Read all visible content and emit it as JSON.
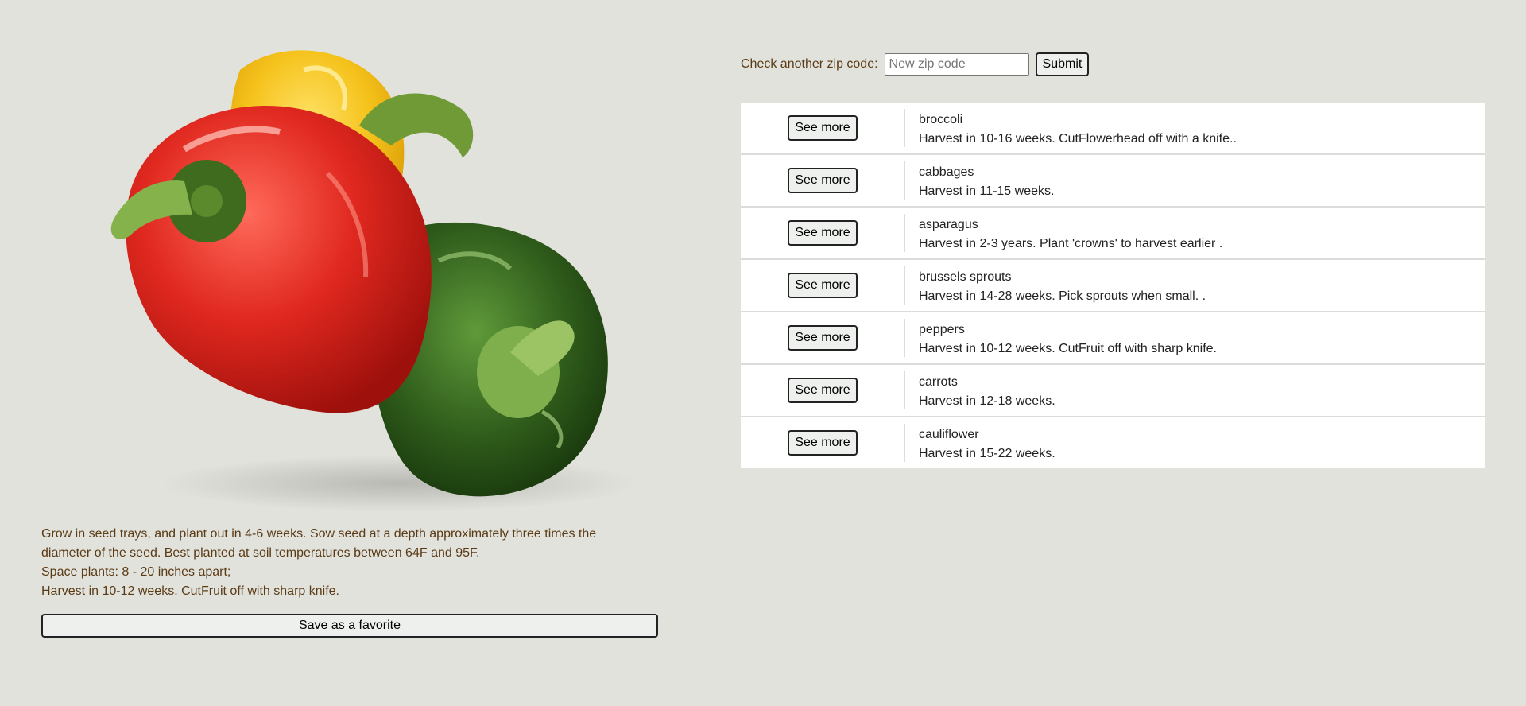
{
  "image": {
    "icon": "bell-peppers-photo",
    "colors": {
      "red": "#d82a23",
      "yellow": "#f5c21b",
      "green": "#2f5c1b"
    }
  },
  "details": {
    "lines": [
      "Grow in seed trays, and plant out in 4-6 weeks. Sow seed at a depth approximately three times the",
      "diameter of the seed. Best planted at soil temperatures between 64F and 95F.",
      "Space plants: 8 - 20 inches apart;",
      "Harvest in 10-12 weeks. CutFruit off with sharp knife."
    ],
    "save_label": "Save as a favorite"
  },
  "zip": {
    "label": "Check another zip code:",
    "value": "",
    "placeholder": "New zip code",
    "submit_label": "Submit"
  },
  "vegetables": [
    {
      "button": "See more",
      "name": "broccoli",
      "harvest": "Harvest in 10-16 weeks. CutFlowerhead off with a knife.."
    },
    {
      "button": "See more",
      "name": "cabbages",
      "harvest": "Harvest in 11-15 weeks."
    },
    {
      "button": "See more",
      "name": "asparagus",
      "harvest": "Harvest in 2-3 years. Plant 'crowns' to harvest earlier ."
    },
    {
      "button": "See more",
      "name": "brussels sprouts",
      "harvest": "Harvest in 14-28 weeks. Pick sprouts when small. ."
    },
    {
      "button": "See more",
      "name": "peppers",
      "harvest": "Harvest in 10-12 weeks. CutFruit off with sharp knife."
    },
    {
      "button": "See more",
      "name": "carrots",
      "harvest": "Harvest in 12-18 weeks."
    },
    {
      "button": "See more",
      "name": "cauliflower",
      "harvest": "Harvest in 15-22 weeks."
    }
  ],
  "colors": {
    "background": "#e2e2dc",
    "body_text": "#5a3b15",
    "button_bg": "#eef0ee"
  }
}
